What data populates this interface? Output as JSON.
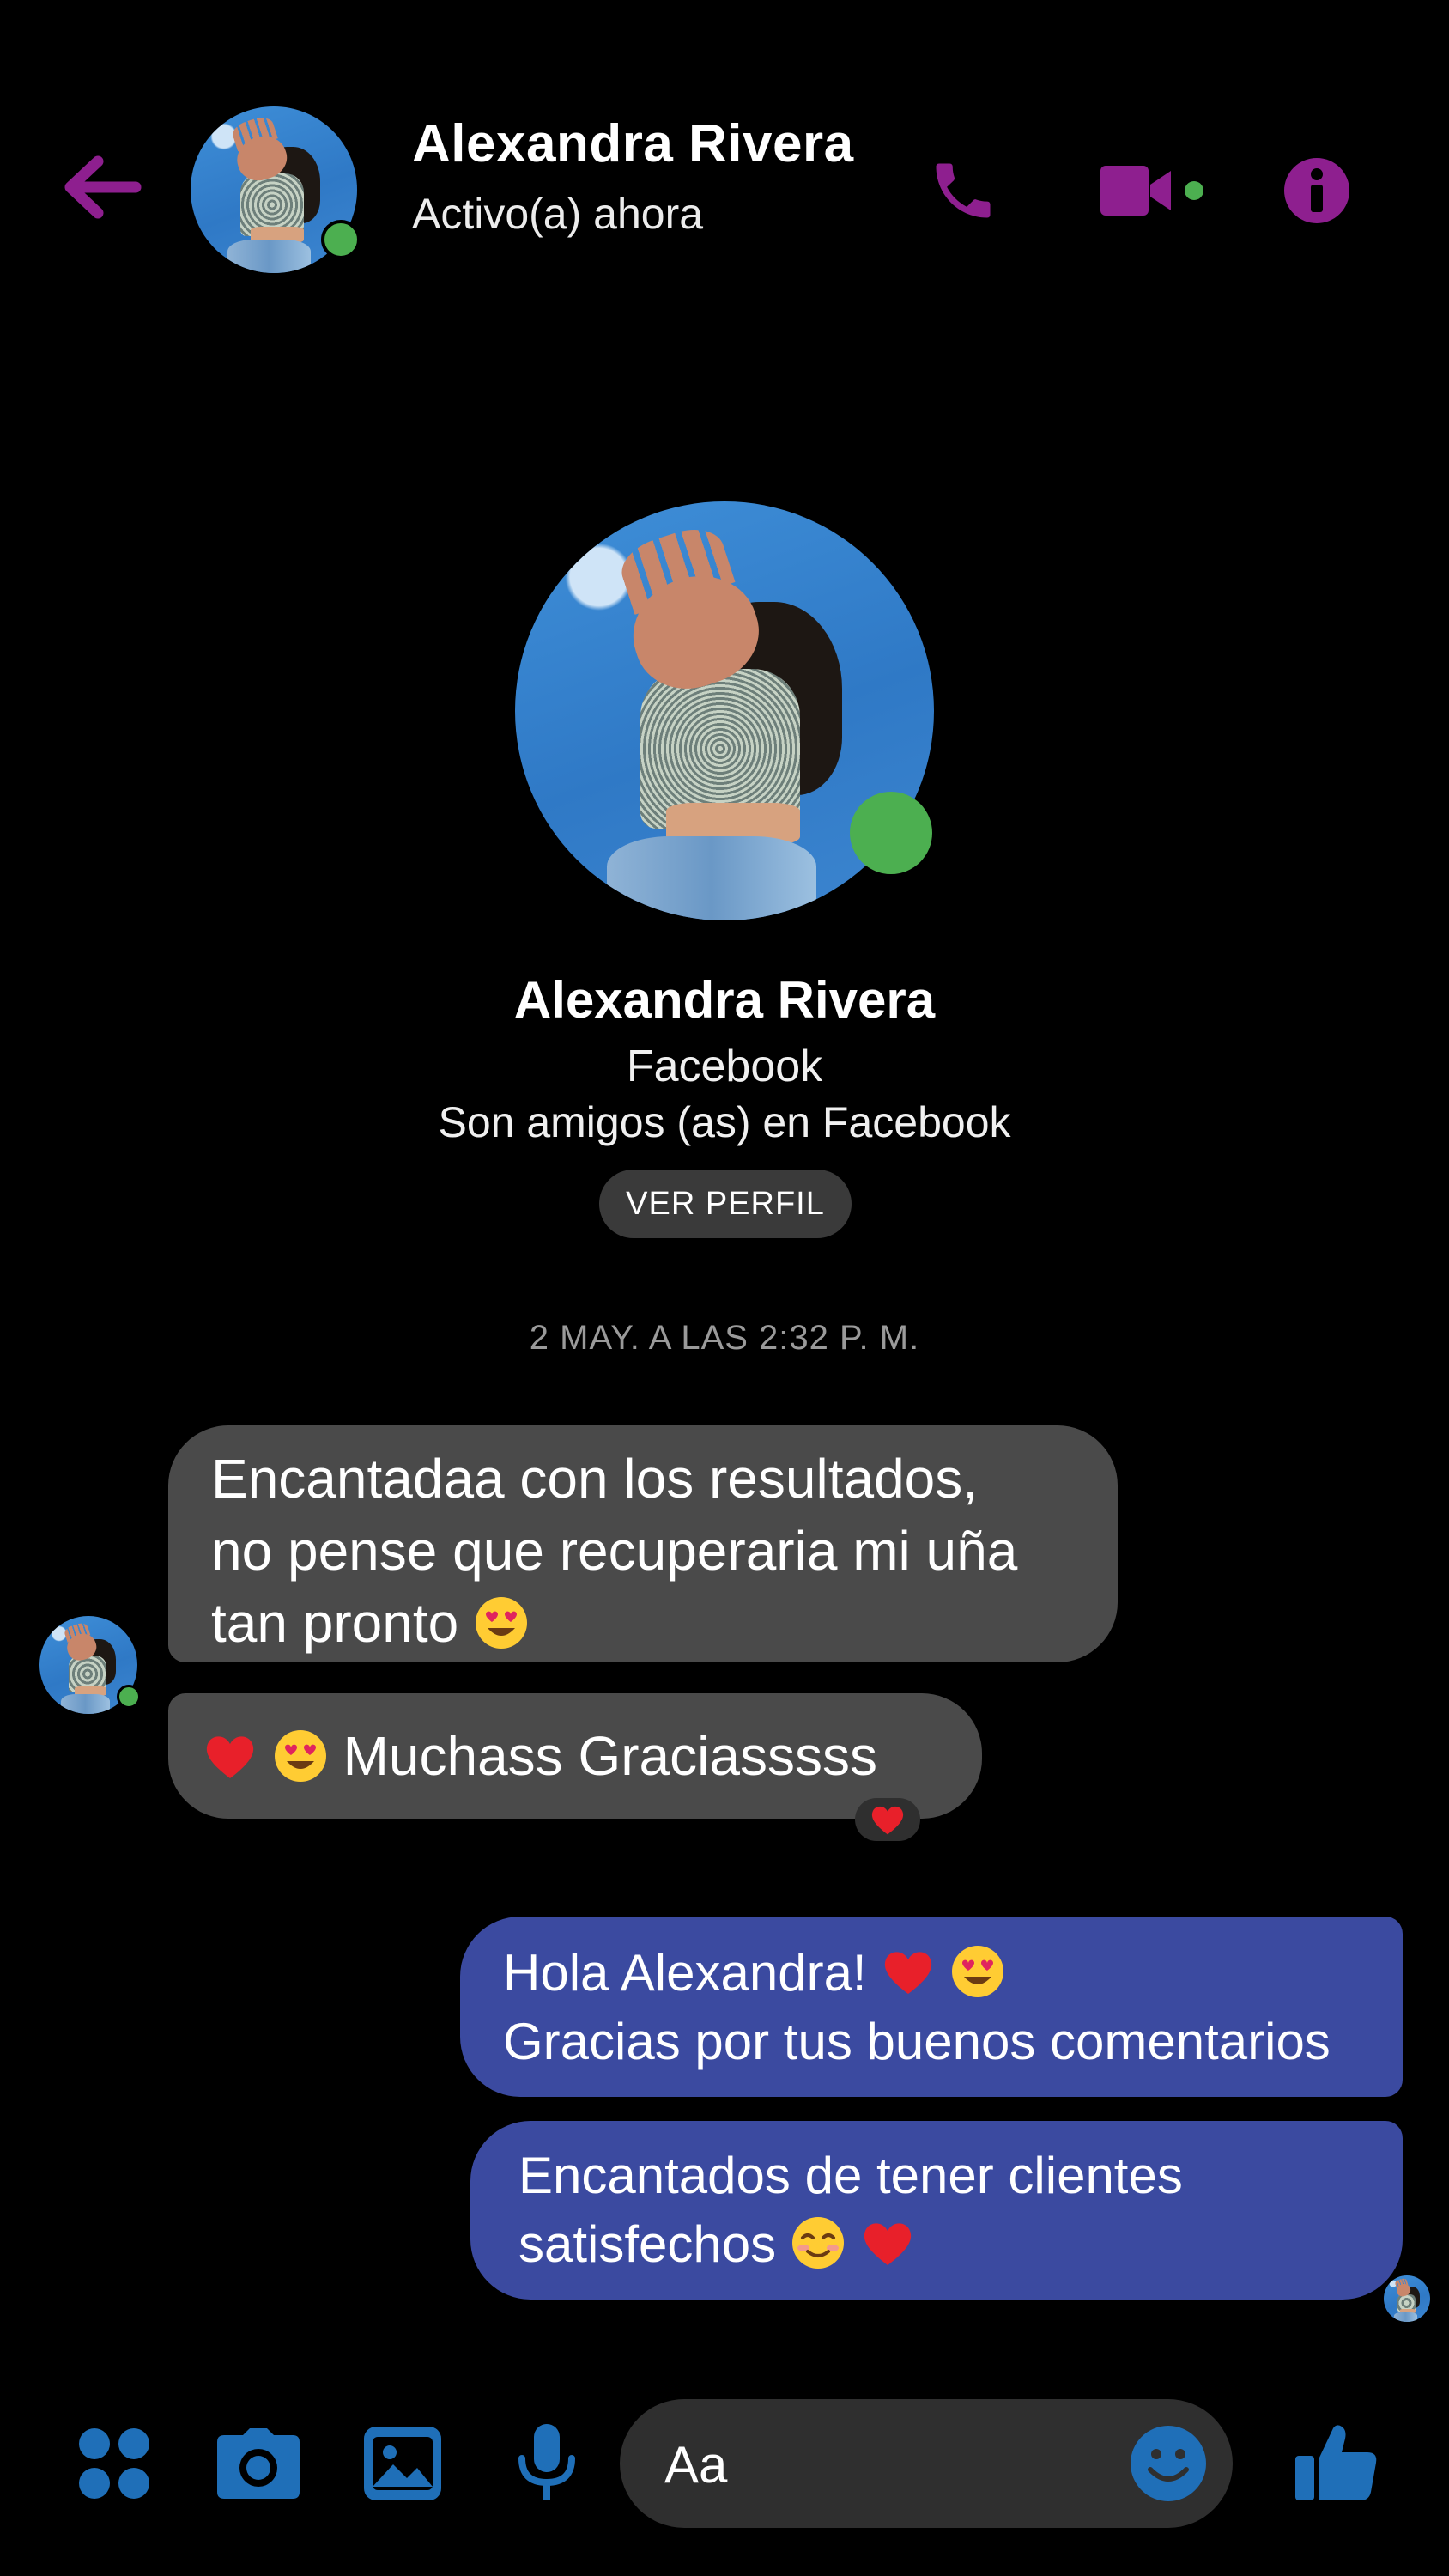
{
  "header": {
    "name": "Alexandra Rivera",
    "status": "Activo(a) ahora"
  },
  "profile": {
    "name": "Alexandra Rivera",
    "source": "Facebook",
    "relationship": "Son amigos (as) en Facebook",
    "view_profile_label": "VER PERFIL"
  },
  "conversation": {
    "timestamp": "2 MAY. A LAS 2:32 P. M.",
    "messages": [
      {
        "from": "contact",
        "lines": [
          "Encantadaa con los resultados,",
          "no pense que recuperaria mi uña",
          "tan pronto"
        ]
      },
      {
        "from": "contact",
        "text": "Muchass Graciasssss",
        "reaction": "heart"
      },
      {
        "from": "me",
        "lines": [
          "Hola Alexandra!",
          "Gracias por tus buenos comentarios"
        ]
      },
      {
        "from": "me",
        "lines": [
          "Encantados de tener clientes",
          "satisfechos"
        ]
      }
    ]
  },
  "composer": {
    "placeholder": "Aa"
  },
  "icons": {
    "header": [
      "back-arrow-icon",
      "phone-icon",
      "video-camera-icon",
      "info-icon"
    ],
    "bottom": [
      "apps-icon",
      "camera-icon",
      "gallery-icon",
      "microphone-icon",
      "emoji-icon",
      "thumbs-up-icon"
    ]
  },
  "colors": {
    "accent_header": "#8e1f8f",
    "accent_bottom": "#1f6fb8",
    "outgoing_bubble": "#3b4aa0",
    "incoming_bubble": "#4a4a4a",
    "online": "#4caf50"
  }
}
